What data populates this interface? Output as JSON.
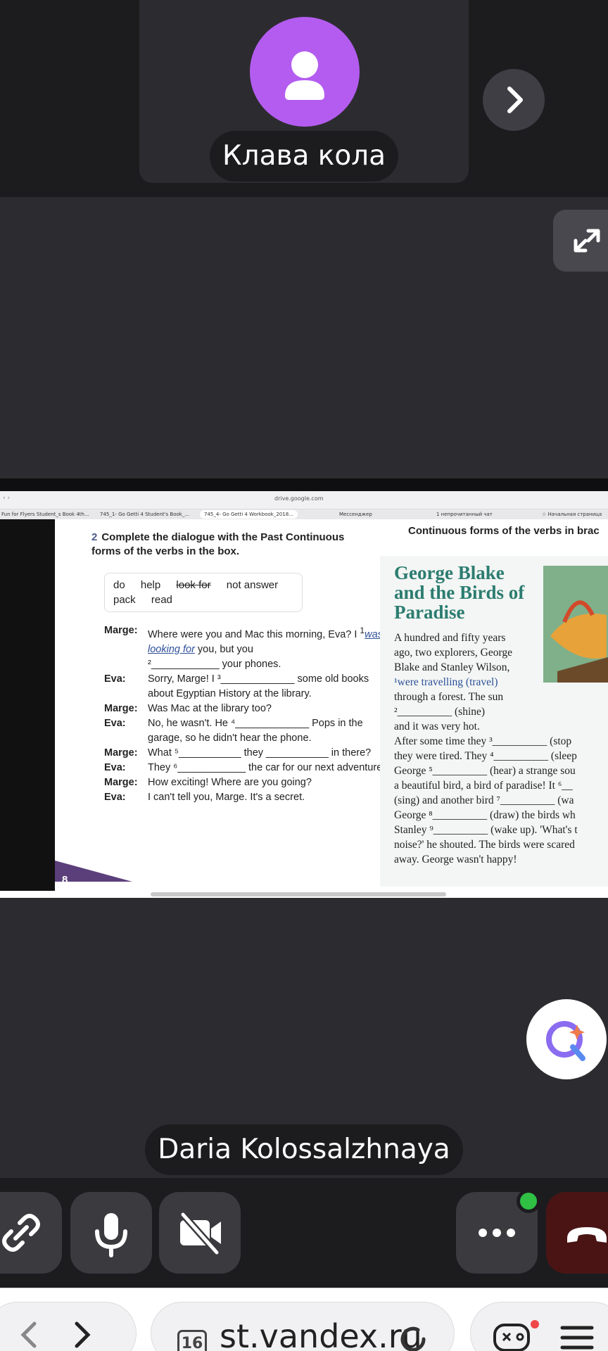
{
  "call": {
    "top_participant": {
      "name": "Клава кола"
    },
    "bottom_participant": {
      "name": "Daria Kolossalzhnaya"
    }
  },
  "shared_browser": {
    "url": "drive.google.com",
    "nav": "‹ ›",
    "tabs": [
      {
        "label": "Fun for Flyers Student_s Book 4th..."
      },
      {
        "label": "745_1- Go Getti 4 Student's Book_..."
      },
      {
        "label": "745_4- Go Getti 4 Workbook_2018...",
        "active": true
      },
      {
        "label": "Мессенджер"
      },
      {
        "label": "1 непрочитанный чат"
      },
      {
        "label": "☆ Начальная страница"
      }
    ]
  },
  "workbook": {
    "exercise_number": "2",
    "exercise_title": "Complete the dialogue with the Past Continuous forms of the verbs in the box.",
    "words": [
      "do",
      "help",
      "look for",
      "not answer",
      "pack",
      "read"
    ],
    "struck_word": "look for",
    "dialogue": [
      {
        "speaker": "Marge:",
        "text_before": "Where were you and Mac this morning, Eva? I ",
        "num": "1",
        "answer": "was looking for",
        "text_after": " you, but you"
      },
      {
        "speaker": "",
        "text": "²____________ your phones."
      },
      {
        "speaker": "Eva:",
        "text": "Sorry, Marge! I ³_____________ some old books about Egyptian History at the library."
      },
      {
        "speaker": "Marge:",
        "text": "Was Mac at the library too?"
      },
      {
        "speaker": "Eva:",
        "text": "No, he wasn't. He ⁴_____________ Pops in the garage, so he didn't hear the phone."
      },
      {
        "speaker": "Marge:",
        "text": "What ⁵___________ they ___________ in there?"
      },
      {
        "speaker": "Eva:",
        "text": "They ⁶____________ the car for our next adventure."
      },
      {
        "speaker": "Marge:",
        "text": "How exciting! Where are you going?"
      },
      {
        "speaker": "Eva:",
        "text": "I can't tell you, Marge. It's a secret."
      }
    ],
    "right_header": "Continuous forms of the verbs in brac",
    "story_title": "George Blake and the Birds of Paradise",
    "story_lines": [
      "A hundred and fifty years",
      "ago, two explorers, George",
      "Blake and Stanley Wilson,",
      "¹were travelling (travel)",
      "through a forest. The sun",
      "²__________ (shine)",
      "and it was very hot.",
      "After some time they ³__________ (stop",
      "they were tired. They ⁴__________ (sleep",
      "George ⁵__________ (hear) a strange sou",
      "a beautiful bird, a bird of paradise! It ⁶__",
      "(sing) and another bird ⁷__________ (wa",
      "George ⁸__________ (draw) the birds wh",
      "Stanley ⁹__________ (wake up). 'What's t",
      "noise?' he shouted. The birds were scared",
      "away. George wasn't happy!"
    ],
    "page_number": "8"
  },
  "controls": {
    "link": "link-icon",
    "mic": "microphone-icon",
    "camera": "camera-off-icon",
    "more": "more-icon",
    "hangup": "hang-up-icon"
  },
  "browser_bottom": {
    "tab_count": "16",
    "url": "st.vandex.ru"
  },
  "colors": {
    "avatar": "#b45cf0",
    "hangup": "#4a1414",
    "online_dot": "#2fc044",
    "story_title": "#2c7c70"
  }
}
